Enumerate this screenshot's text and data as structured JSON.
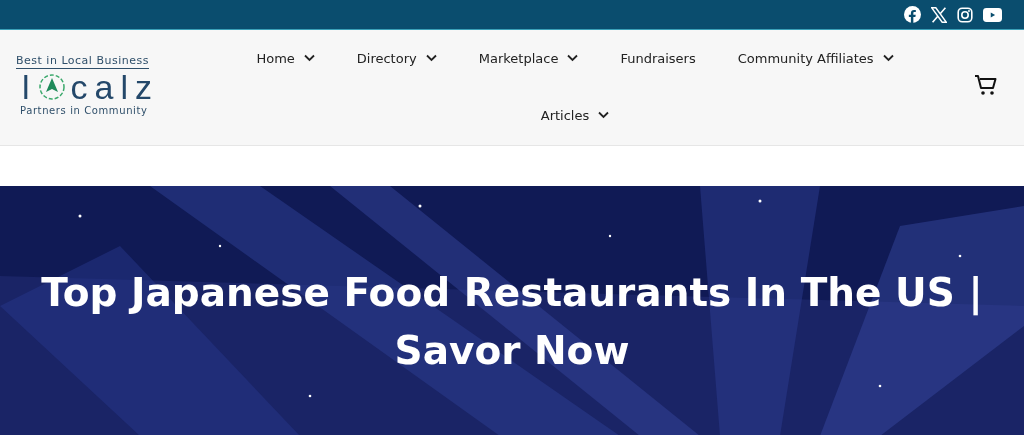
{
  "logo": {
    "top": "Best in Local Business",
    "before_mark": "l",
    "after_mark": "calz",
    "bottom": "Partners in Community"
  },
  "nav": [
    {
      "label": "Home",
      "dropdown": true
    },
    {
      "label": "Directory",
      "dropdown": true
    },
    {
      "label": "Marketplace",
      "dropdown": true
    },
    {
      "label": "Fundraisers",
      "dropdown": false
    },
    {
      "label": "Community Affiliates",
      "dropdown": true
    },
    {
      "label": "Articles",
      "dropdown": true
    }
  ],
  "hero": {
    "title": "Top Japanese Food Restaurants In The US | Savor Now"
  }
}
